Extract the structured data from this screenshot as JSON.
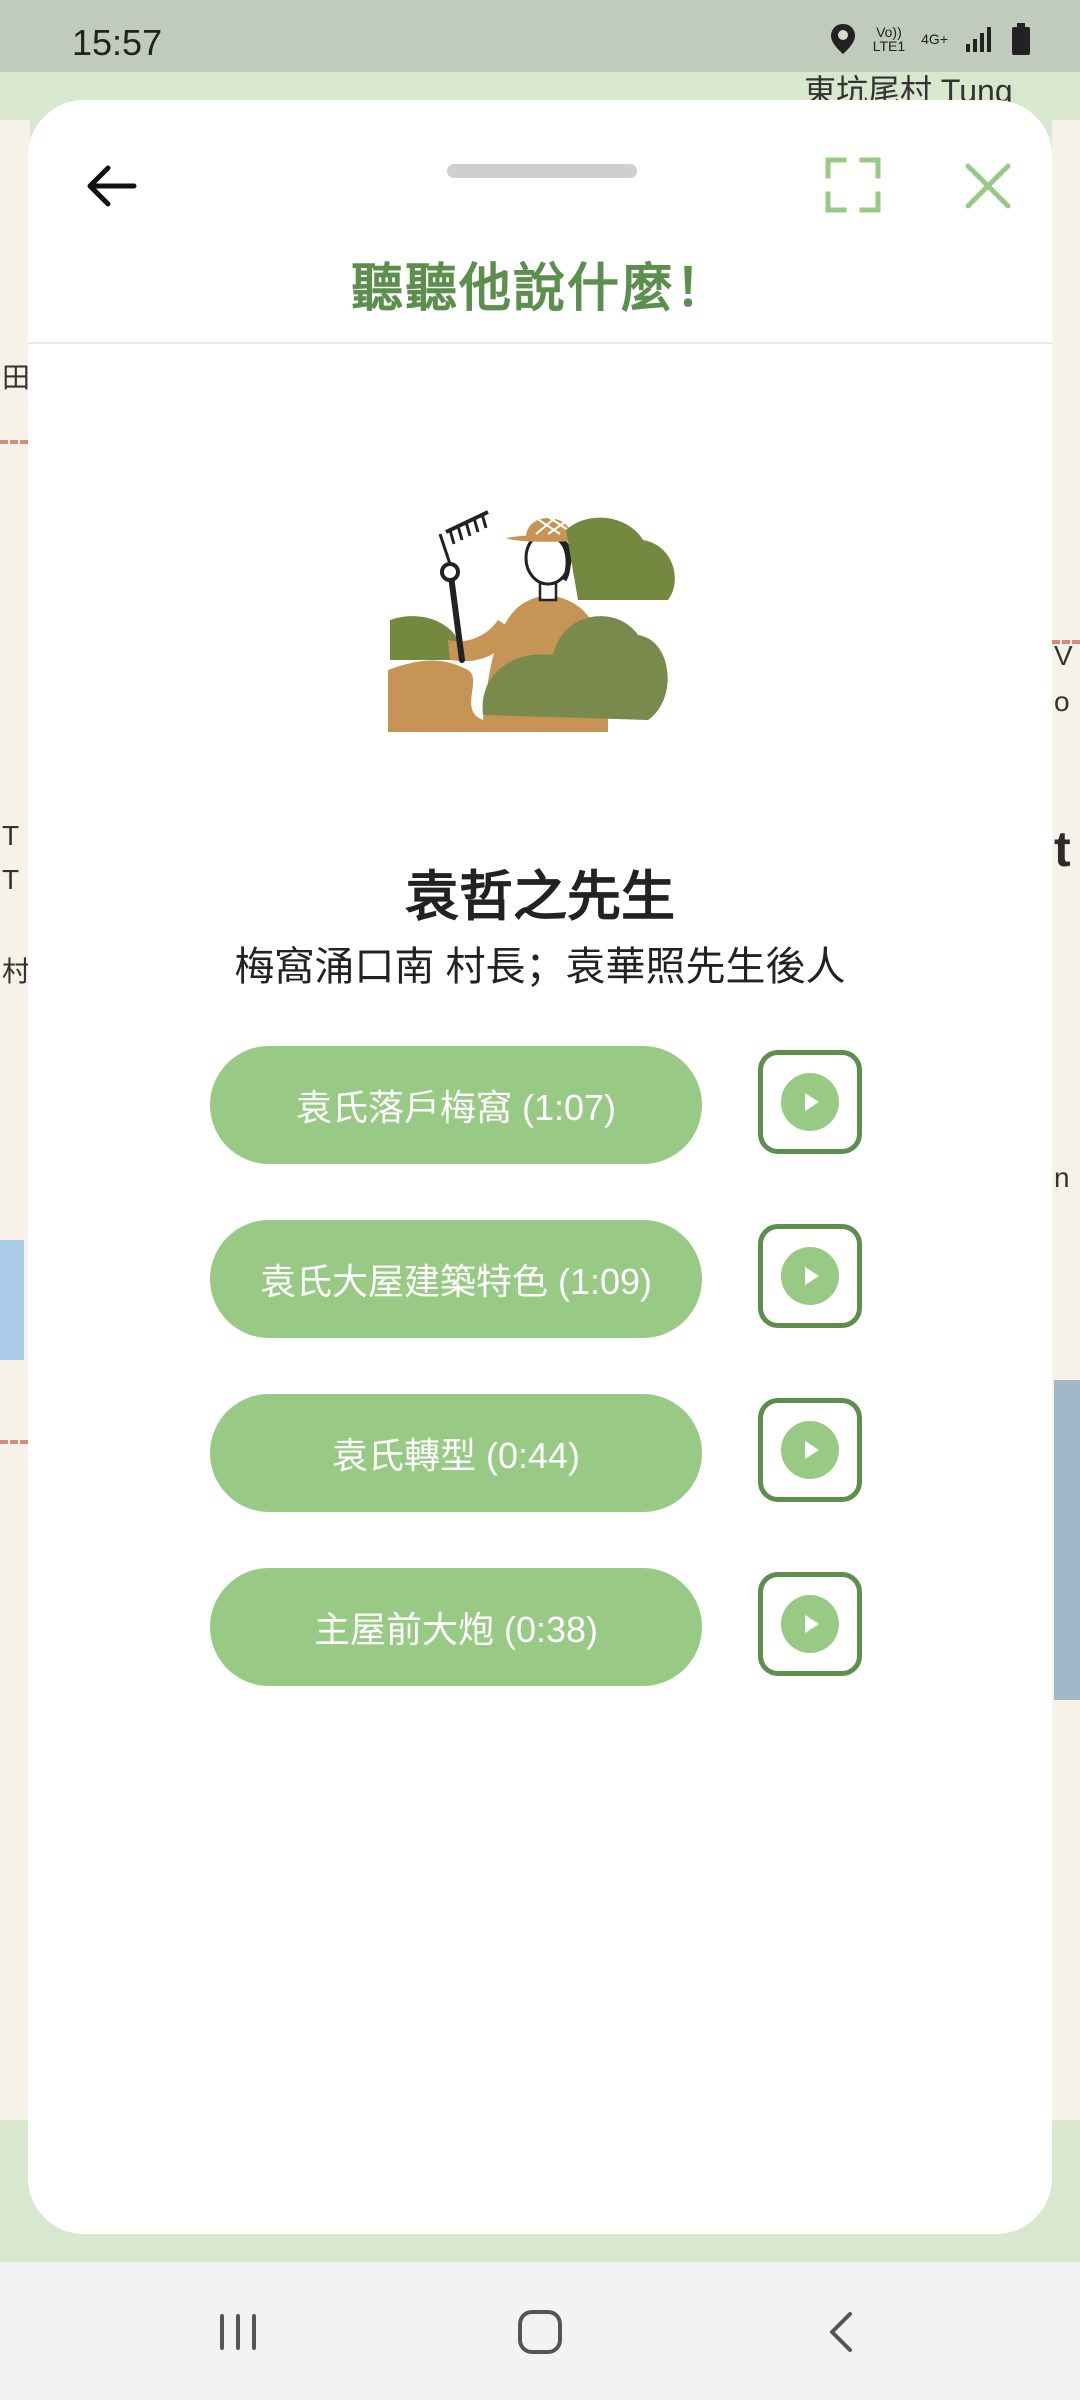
{
  "status_bar": {
    "time": "15:57",
    "network_top": "Vo))",
    "network_bottom": "LTE1",
    "signal_label": "4G+",
    "icons": [
      "location-icon",
      "signal-icon",
      "battery-icon"
    ]
  },
  "map": {
    "labels": {
      "top_place": "東坑尾村 Tung",
      "left_1": "田",
      "left_2": "T",
      "left_3": "T",
      "left_4": "村",
      "right_1": "V",
      "right_2": "o",
      "right_3": "t",
      "right_4": "n"
    }
  },
  "panel": {
    "title": "聽聽他說什麼！",
    "person_name": "袁哲之先生",
    "person_desc": "梅窩涌口南 村長；袁華照先生後人",
    "illustration": "farmer-with-rake-illustration",
    "clips": [
      {
        "label": "袁氏落戶梅窩 (1:07)"
      },
      {
        "label": "袁氏大屋建築特色 (1:09)"
      },
      {
        "label": "袁氏轉型 (0:44)"
      },
      {
        "label": "主屋前大炮 (0:38)"
      }
    ],
    "icons": {
      "back": "arrow-left-icon",
      "expand": "expand-icon",
      "close": "close-icon",
      "play": "play-icon"
    }
  },
  "colors": {
    "accent": "#5c8f4e",
    "button_fill": "#98ca85",
    "card_bg": "#ffffff"
  },
  "nav_bar": {
    "items": [
      "recents-icon",
      "home-icon",
      "back-icon"
    ]
  }
}
